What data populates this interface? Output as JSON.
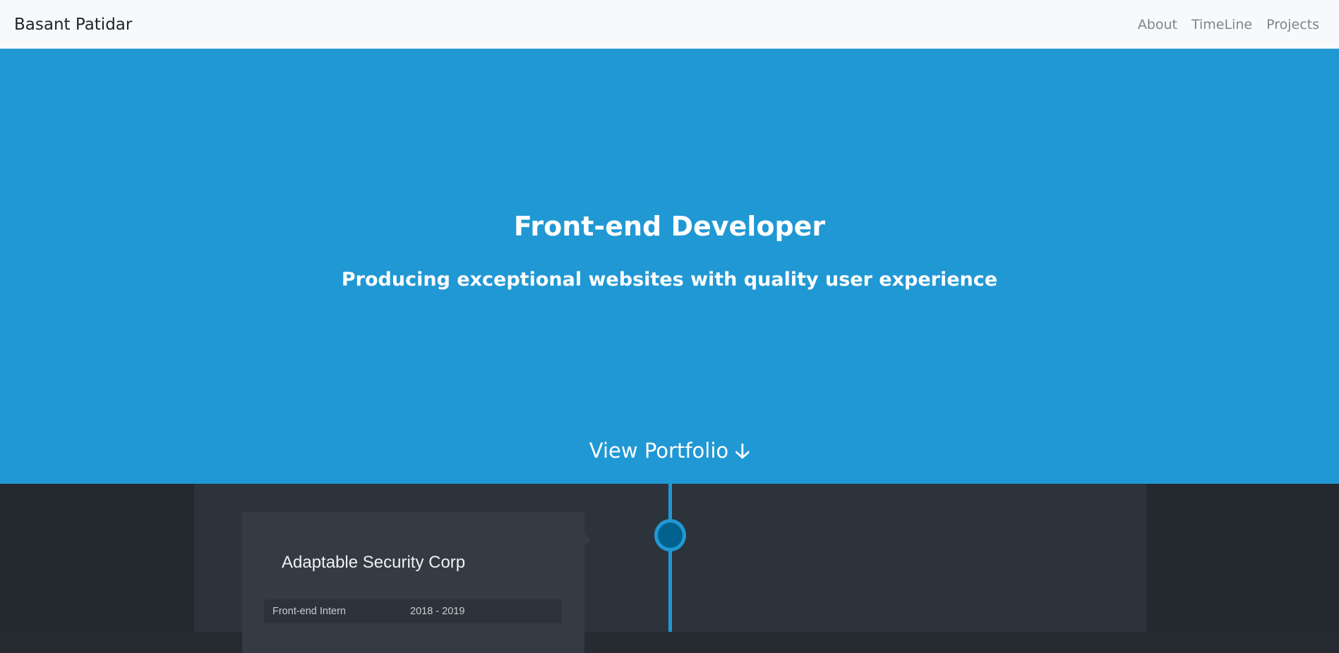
{
  "navbar": {
    "brand": "Basant Patidar",
    "links": [
      "About",
      "TimeLine",
      "Projects"
    ]
  },
  "hero": {
    "title": "Front-end Developer",
    "subtitle": "Producing exceptional websites with quality user experience",
    "cta": "View Portfolio",
    "cta_icon": "arrow-down-icon"
  },
  "timeline": {
    "items": [
      {
        "company": "Adaptable Security Corp",
        "role": "Front-end Intern",
        "period": "2018 - 2019"
      }
    ]
  },
  "colors": {
    "accent": "#2098d4",
    "dark": "#2d333b"
  }
}
